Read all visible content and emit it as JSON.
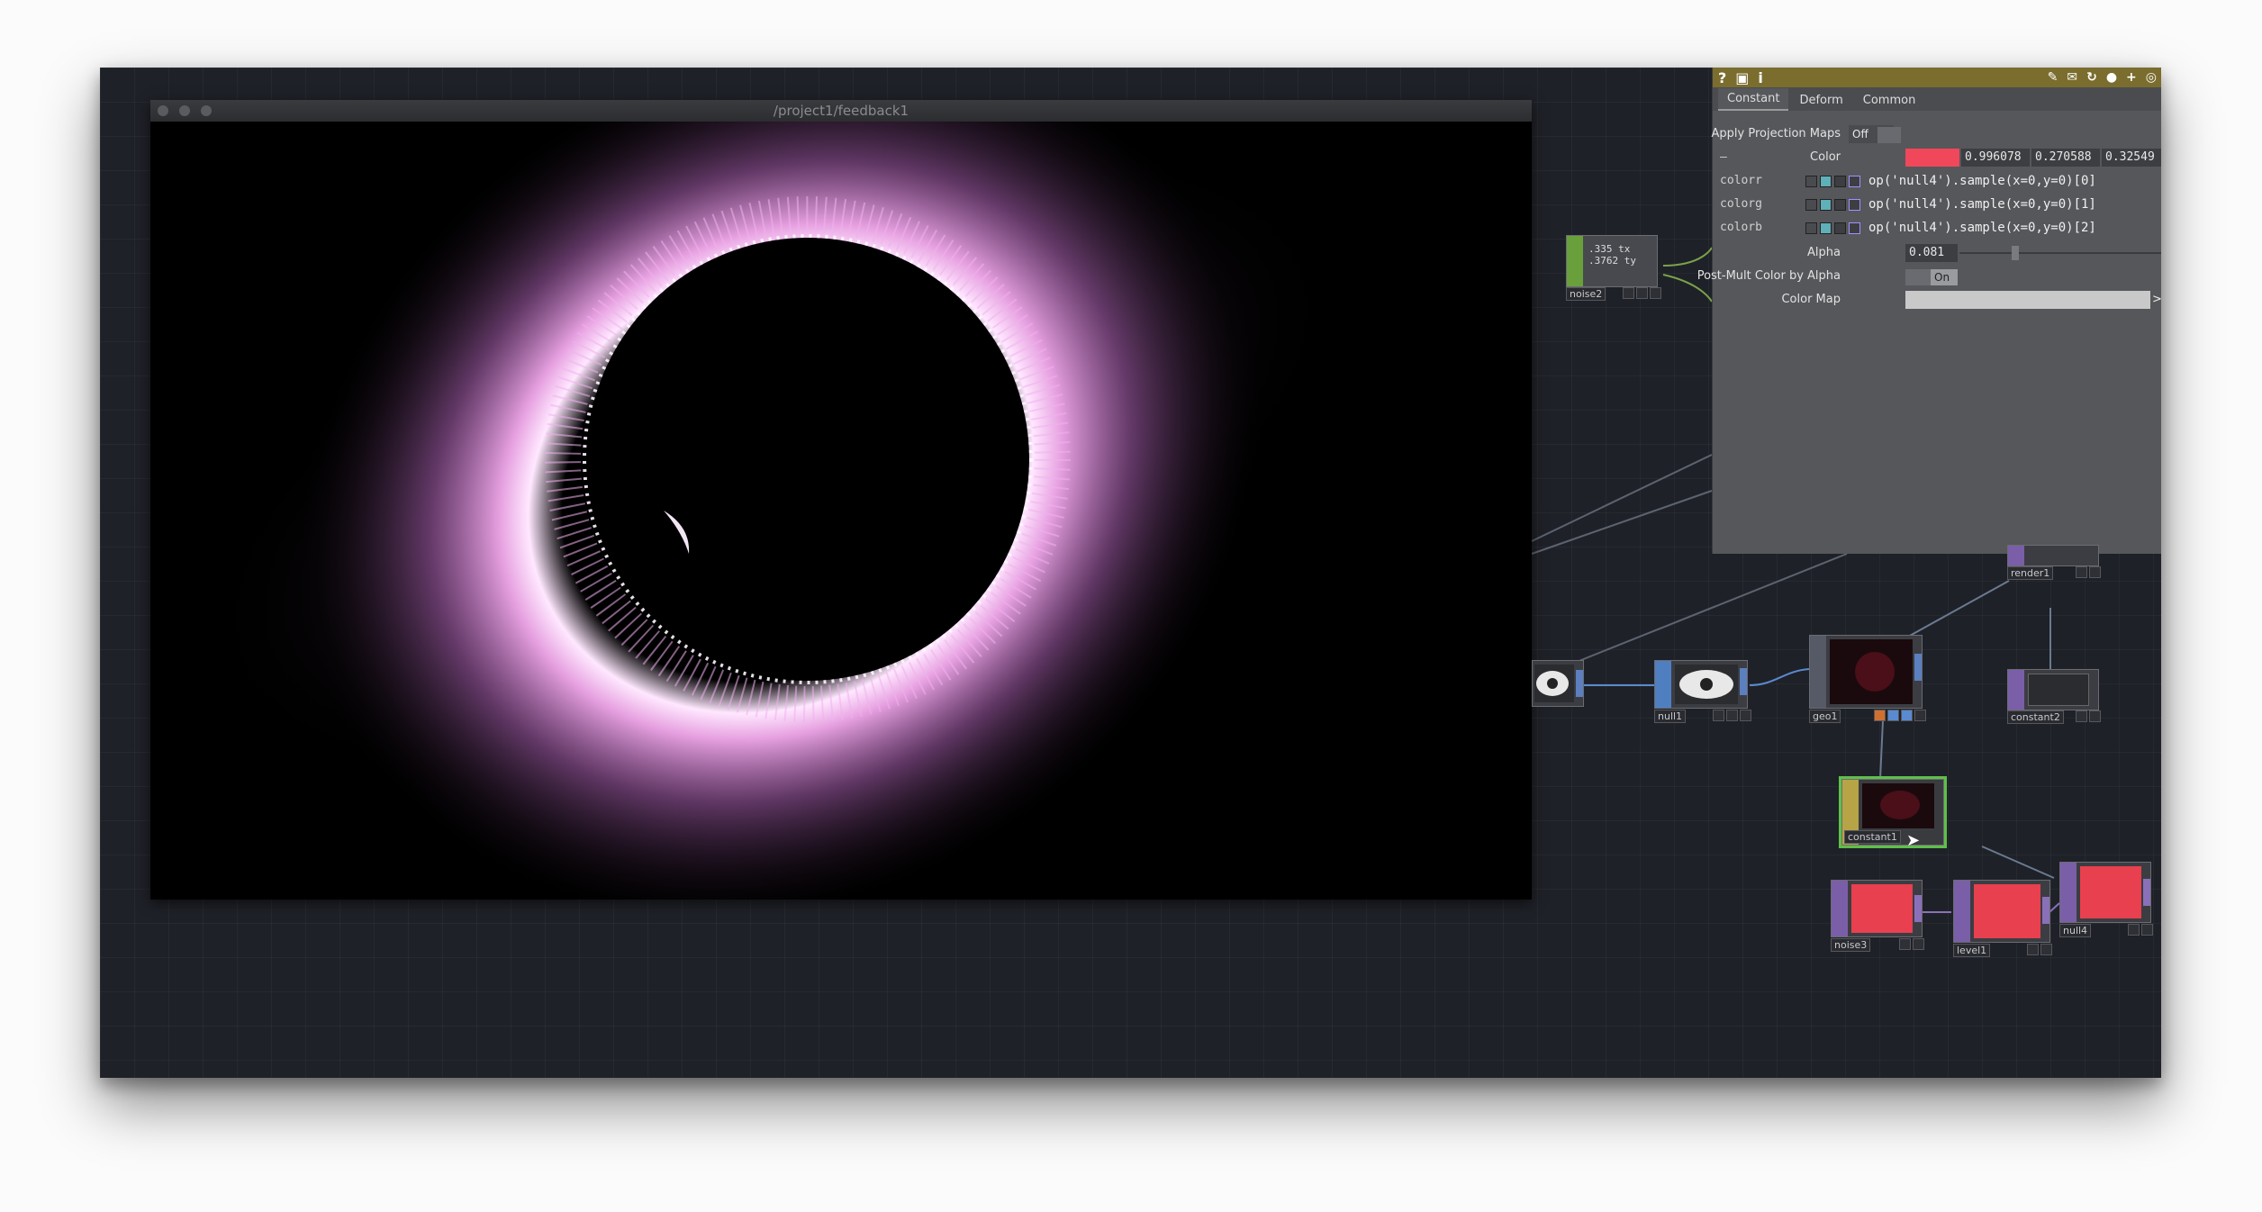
{
  "viewer": {
    "title": "/project1/feedback1"
  },
  "panel": {
    "toolbar": {
      "help": "?",
      "info": "i",
      "add": "+"
    },
    "tabs": [
      "Constant",
      "Deform",
      "Common"
    ],
    "apply_projection_label": "Apply Projection Maps",
    "apply_projection_value": "Off",
    "color_label": "Color",
    "color_swatch": "#f0475a",
    "color_r": "0.996078",
    "color_g": "0.270588",
    "color_b": "0.32549",
    "collapse": "—",
    "expr_rows": [
      {
        "var": "colorr",
        "expr": "op('null4').sample(x=0,y=0)[0]"
      },
      {
        "var": "colorg",
        "expr": "op('null4').sample(x=0,y=0)[1]"
      },
      {
        "var": "colorb",
        "expr": "op('null4').sample(x=0,y=0)[2]"
      }
    ],
    "alpha_label": "Alpha",
    "alpha_value": "0.081",
    "alpha_fraction": 0.081,
    "postmult_label": "Post-Mult Color by Alpha",
    "postmult_value": "On",
    "colormap_label": "Color Map",
    "colormap_arrow": ">"
  },
  "nodes": {
    "noise2": {
      "label": "noise2",
      "val1": ".335",
      "ch1": "tx",
      "val2": ".3762",
      "ch2": "ty"
    },
    "render1": {
      "label": "render1"
    },
    "null1": {
      "label": "null1"
    },
    "geo1": {
      "label": "geo1"
    },
    "constant2": {
      "label": "constant2"
    },
    "constant1": {
      "label": "constant1"
    },
    "noise3": {
      "label": "noise3"
    },
    "level1": {
      "label": "level1"
    },
    "null4": {
      "label": "null4"
    }
  },
  "colors": {
    "red_swatch": "#e8404f",
    "chop_green": "#6aa03c",
    "top_purple": "#7b5ea8",
    "sop_blue": "#4f7fc0",
    "mat_yellow": "#b7a447",
    "selection": "#5fc04a"
  }
}
